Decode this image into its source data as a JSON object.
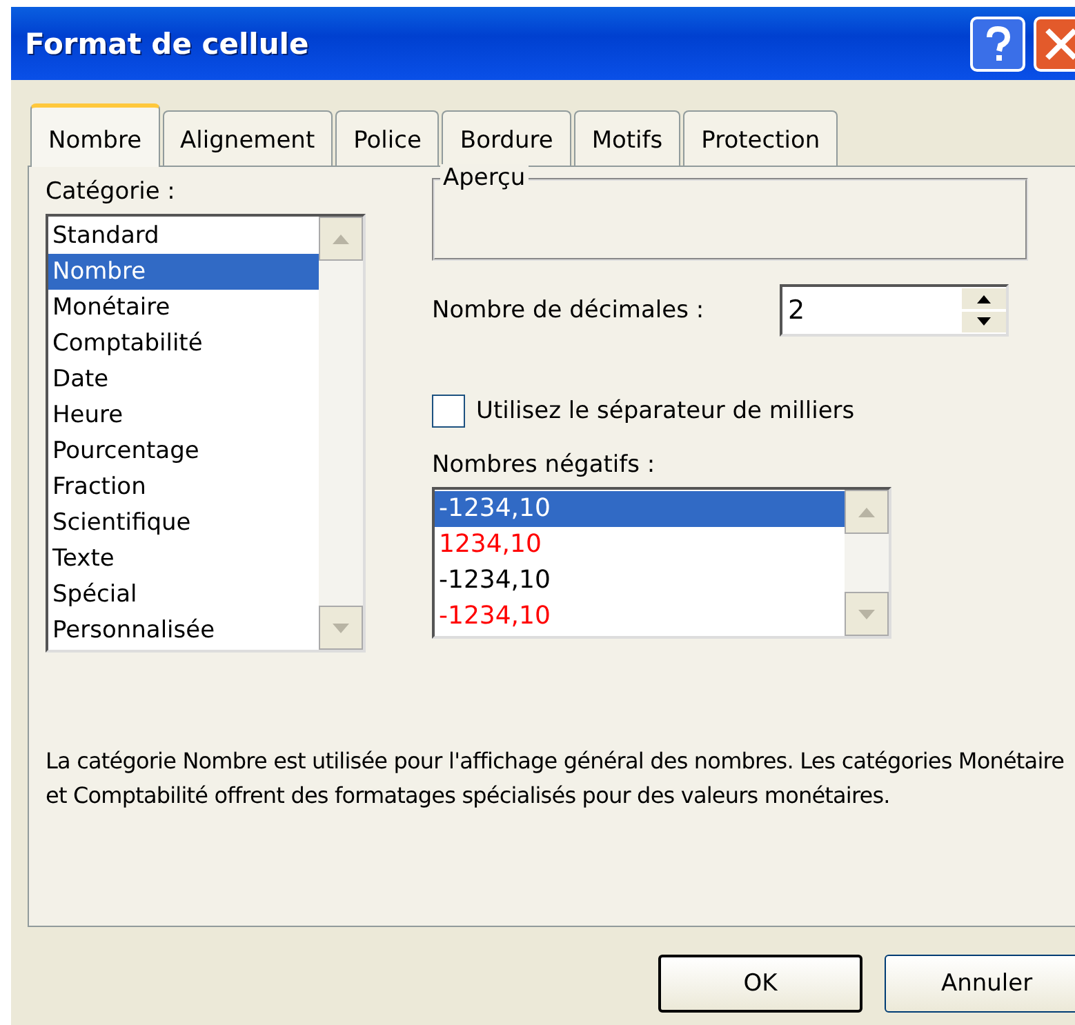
{
  "window": {
    "title": "Format de cellule"
  },
  "tabs": [
    {
      "label": "Nombre",
      "selected": true
    },
    {
      "label": "Alignement",
      "selected": false
    },
    {
      "label": "Police",
      "selected": false
    },
    {
      "label": "Bordure",
      "selected": false
    },
    {
      "label": "Motifs",
      "selected": false
    },
    {
      "label": "Protection",
      "selected": false
    }
  ],
  "category": {
    "label": "Catégorie :",
    "items": [
      {
        "label": "Standard",
        "selected": false
      },
      {
        "label": "Nombre",
        "selected": true
      },
      {
        "label": "Monétaire",
        "selected": false
      },
      {
        "label": "Comptabilité",
        "selected": false
      },
      {
        "label": "Date",
        "selected": false
      },
      {
        "label": "Heure",
        "selected": false
      },
      {
        "label": "Pourcentage",
        "selected": false
      },
      {
        "label": "Fraction",
        "selected": false
      },
      {
        "label": "Scientifique",
        "selected": false
      },
      {
        "label": "Texte",
        "selected": false
      },
      {
        "label": "Spécial",
        "selected": false
      },
      {
        "label": "Personnalisée",
        "selected": false
      }
    ]
  },
  "preview": {
    "label": "Aperçu"
  },
  "decimals": {
    "label": "Nombre de décimales :",
    "value": "2"
  },
  "thousands_separator": {
    "label": "Utilisez le séparateur de milliers",
    "checked": false
  },
  "negative_numbers": {
    "label": "Nombres négatifs :",
    "items": [
      {
        "label": "-1234,10",
        "selected": true
      },
      {
        "label": "1234,10",
        "selected": false,
        "color": "#ff0000"
      },
      {
        "label": "-1234,10",
        "selected": false,
        "color": "#000000"
      },
      {
        "label": "-1234,10",
        "selected": false,
        "color": "#ff0000"
      }
    ]
  },
  "description": "La catégorie Nombre est utilisée pour l'affichage général des nombres. Les catégories Monétaire et Comptabilité offrent des formatages spécialisés pour des valeurs monétaires.",
  "buttons": [
    {
      "label": "OK",
      "default": true
    },
    {
      "label": "Annuler",
      "default": false
    }
  ]
}
